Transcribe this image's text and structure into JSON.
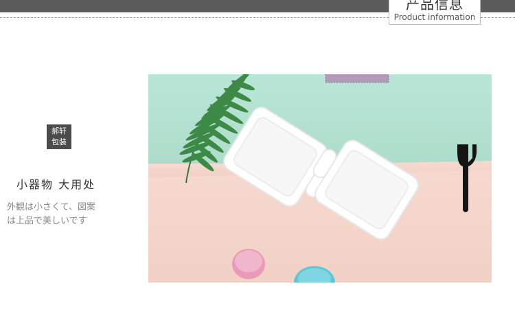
{
  "header": {
    "title": "产品信息",
    "subtitle": "Product information"
  },
  "badge": {
    "line1": "郝轩",
    "line2": "包装"
  },
  "section": {
    "heading": "小器物 大用处",
    "description_line1": "外観は小さくて、図案",
    "description_line2": "は上品で美しいです"
  },
  "colors": {
    "top_band": "#5b5b5b",
    "badge_bg": "#4b4b4b",
    "mint": "#b4e2d3",
    "peach": "#f5d6cc",
    "fern": "#2f7a3b",
    "macaron_pink": "#e69ab8",
    "macaron_blue": "#5cc7d6"
  }
}
